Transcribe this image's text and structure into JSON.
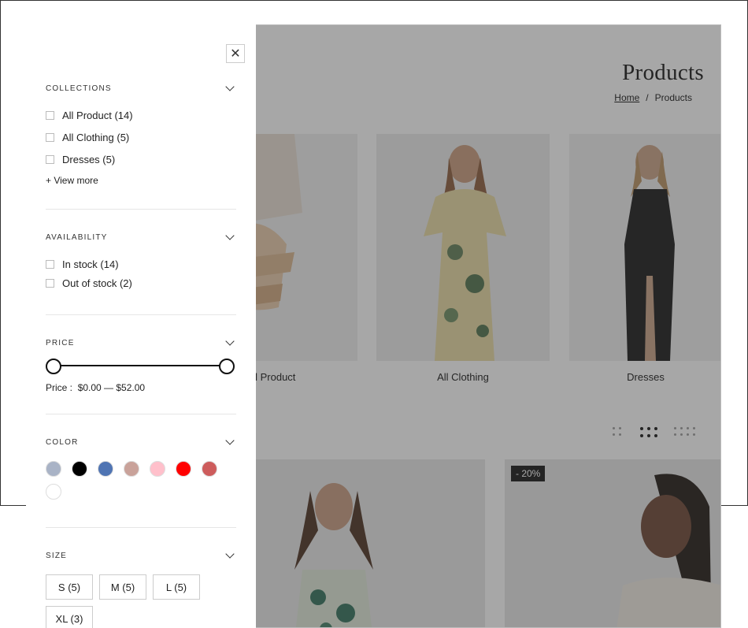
{
  "page": {
    "title": "Products",
    "breadcrumb": {
      "home": "Home",
      "separator": "/",
      "current": "Products"
    }
  },
  "collections_cards": [
    {
      "label": "All Product"
    },
    {
      "label": "All Clothing"
    },
    {
      "label": "Dresses"
    }
  ],
  "grid_badge": "- 20%",
  "filters": {
    "collections": {
      "heading": "COLLECTIONS",
      "options": [
        "All Product (14)",
        "All Clothing (5)",
        "Dresses (5)"
      ],
      "view_more": "+ View more"
    },
    "availability": {
      "heading": "AVAILABILITY",
      "options": [
        "In stock (14)",
        "Out of stock (2)"
      ]
    },
    "price": {
      "heading": "PRICE",
      "label": "Price :",
      "range_text": "$0.00 — $52.00",
      "min": 0,
      "max": 52
    },
    "color": {
      "heading": "COLOR",
      "swatches": [
        "#a9b3c6",
        "#000000",
        "#4f74b3",
        "#c9a29a",
        "#ffc0cb",
        "#ff0000",
        "#cd5c5c",
        "#ffffff"
      ]
    },
    "size": {
      "heading": "SIZE",
      "options": [
        "S (5)",
        "M (5)",
        "L (5)",
        "XL (3)"
      ]
    }
  }
}
